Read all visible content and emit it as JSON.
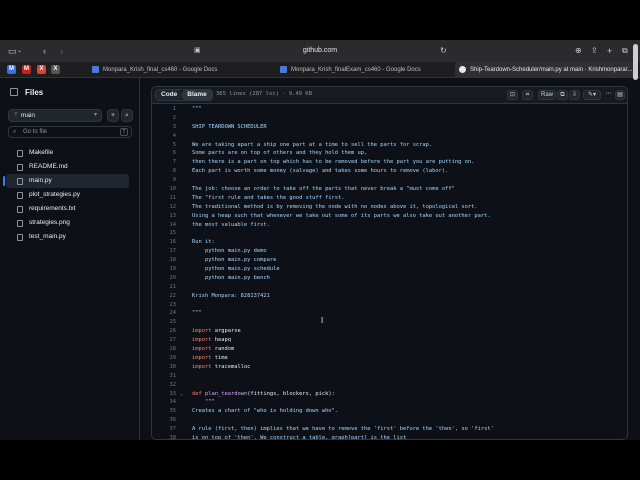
{
  "browser": {
    "url": "github.com",
    "tabs": [
      {
        "label": "Monpara_Krish_final_cs460 - Google Docs"
      },
      {
        "label": "Monpara_Krish_finalExam_cs460 - Google Docs"
      },
      {
        "label": "Ship-Teardown-Scheduler/main.py at main · Krishmonpara/..."
      }
    ],
    "pinned": [
      "M",
      "M",
      "X"
    ]
  },
  "sidebar": {
    "title": "Files",
    "branch": "main",
    "search_placeholder": "Go to file",
    "search_shortcut": "T",
    "files": [
      "Makefile",
      "README.md",
      "main.py",
      "plot_strategies.py",
      "requirements.txt",
      "strategies.png",
      "test_main.py"
    ],
    "selected": "main.py"
  },
  "viewer": {
    "tab_code": "Code",
    "tab_blame": "Blame",
    "meta": "365 lines (287 loc) · 9.49 KB",
    "raw_label": "Raw"
  },
  "code_lines": [
    {
      "n": "1",
      "t": "\"\"\""
    },
    {
      "n": "2",
      "t": ""
    },
    {
      "n": "3",
      "t": "SHIP TEARDOWN SCHEDULER"
    },
    {
      "n": "4",
      "t": ""
    },
    {
      "n": "5",
      "t": "We are taking apart a ship one part at a time to sell the parts for scrap."
    },
    {
      "n": "6",
      "t": "Some parts are on top of others and they hold them up,"
    },
    {
      "n": "7",
      "t": "then there is a part on top which has to be removed before the part you are putting on."
    },
    {
      "n": "8",
      "t": "Each part is worth some money (salvage) and takes some hours to remove (labor)."
    },
    {
      "n": "9",
      "t": ""
    },
    {
      "n": "10",
      "t": "The job: choose an order to take off the parts that never break a \"must come off\""
    },
    {
      "n": "11",
      "t": "The \"first rule and takes the good stuff first."
    },
    {
      "n": "12",
      "t": "The traditional method is by removing the node with no nodes above it, topological sort."
    },
    {
      "n": "13",
      "t": "Using a heap such that whenever we take out some of its parts we also take out another part."
    },
    {
      "n": "14",
      "t": "the most valuable first."
    },
    {
      "n": "15",
      "t": ""
    },
    {
      "n": "16",
      "t": "Run it:"
    },
    {
      "n": "17",
      "t": "    python main.py demo"
    },
    {
      "n": "18",
      "t": "    python main.py compare"
    },
    {
      "n": "19",
      "t": "    python main.py schedule"
    },
    {
      "n": "20",
      "t": "    python main.py bench"
    },
    {
      "n": "21",
      "t": ""
    },
    {
      "n": "22",
      "t": "Krish Monpara: 828137421"
    },
    {
      "n": "23",
      "t": ""
    },
    {
      "n": "24",
      "t": "\"\"\""
    },
    {
      "n": "25",
      "t": ""
    },
    {
      "n": "26",
      "kw": "import",
      "t": " argparse"
    },
    {
      "n": "27",
      "kw": "import",
      "t": " heapq"
    },
    {
      "n": "28",
      "kw": "import",
      "t": " random"
    },
    {
      "n": "29",
      "kw": "import",
      "t": " time"
    },
    {
      "n": "30",
      "kw": "import",
      "t": " tracemalloc"
    },
    {
      "n": "31",
      "t": ""
    },
    {
      "n": "32",
      "t": ""
    },
    {
      "n": "33",
      "kw": "def",
      "fn": " plan_teardown",
      "t": "(fittings, blockers, pick):"
    },
    {
      "n": "34",
      "t": "    \"\"\""
    },
    {
      "n": "35",
      "t": "Creates a chart of \"who is holding down who\"."
    },
    {
      "n": "36",
      "t": ""
    },
    {
      "n": "37",
      "t": "A rule (first, then) implies that we have to remove the 'first' before the 'then', so 'first'"
    },
    {
      "n": "38",
      "t": "is on top of 'then'. We construct a table, graph[part] is the list"
    }
  ]
}
